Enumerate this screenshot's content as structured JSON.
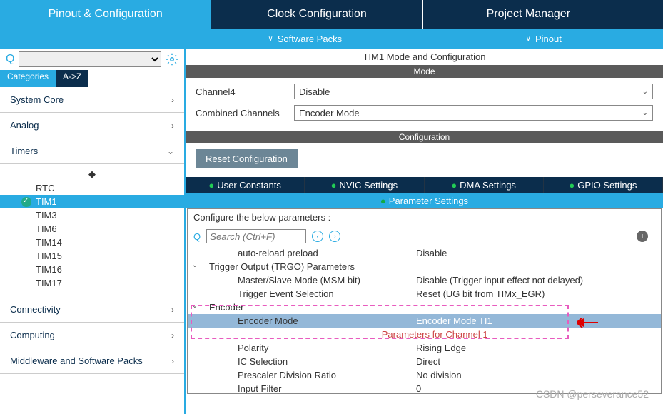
{
  "tabs": {
    "pinout": "Pinout & Configuration",
    "clock": "Clock Configuration",
    "project": "Project Manager"
  },
  "subbar": {
    "software_packs": "Software Packs",
    "pinout": "Pinout"
  },
  "search": {
    "placeholder": ""
  },
  "cat_tabs": {
    "categories": "Categories",
    "az": "A->Z"
  },
  "categories": {
    "system_core": "System Core",
    "analog": "Analog",
    "timers": "Timers",
    "connectivity": "Connectivity",
    "computing": "Computing",
    "middleware": "Middleware and Software Packs"
  },
  "timers_items": {
    "rtc": "RTC",
    "tim1": "TIM1",
    "tim3": "TIM3",
    "tim6": "TIM6",
    "tim14": "TIM14",
    "tim15": "TIM15",
    "tim16": "TIM16",
    "tim17": "TIM17"
  },
  "content": {
    "title": "TIM1 Mode and Configuration",
    "mode_label": "Mode",
    "channel4_label": "Channel4",
    "channel4_value": "Disable",
    "combined_label": "Combined Channels",
    "combined_value": "Encoder Mode",
    "configuration_label": "Configuration",
    "reset_btn": "Reset Configuration"
  },
  "config_tabs": {
    "user_constants": "User Constants",
    "nvic": "NVIC Settings",
    "dma": "DMA Settings",
    "gpio": "GPIO Settings",
    "param": "Parameter Settings"
  },
  "params": {
    "header": "Configure the below parameters :",
    "search_placeholder": "Search (Ctrl+F)",
    "auto_reload": "auto-reload preload",
    "auto_reload_val": "Disable",
    "trgo_group": "Trigger Output (TRGO) Parameters",
    "msm": "Master/Slave Mode (MSM bit)",
    "msm_val": "Disable (Trigger input effect not delayed)",
    "tes": "Trigger Event Selection",
    "tes_val": "Reset (UG bit from TIMx_EGR)",
    "encoder_group": "Encoder",
    "encoder_mode": "Encoder Mode",
    "encoder_mode_val": "Encoder Mode TI1",
    "ch1_group": "Parameters for Channel 1",
    "polarity": "Polarity",
    "polarity_val": "Rising Edge",
    "ic_sel": "IC Selection",
    "ic_sel_val": "Direct",
    "presc": "Prescaler Division Ratio",
    "presc_val": "No division",
    "input_filter": "Input Filter",
    "input_filter_val": "0"
  },
  "watermark": "CSDN @perseverance52"
}
